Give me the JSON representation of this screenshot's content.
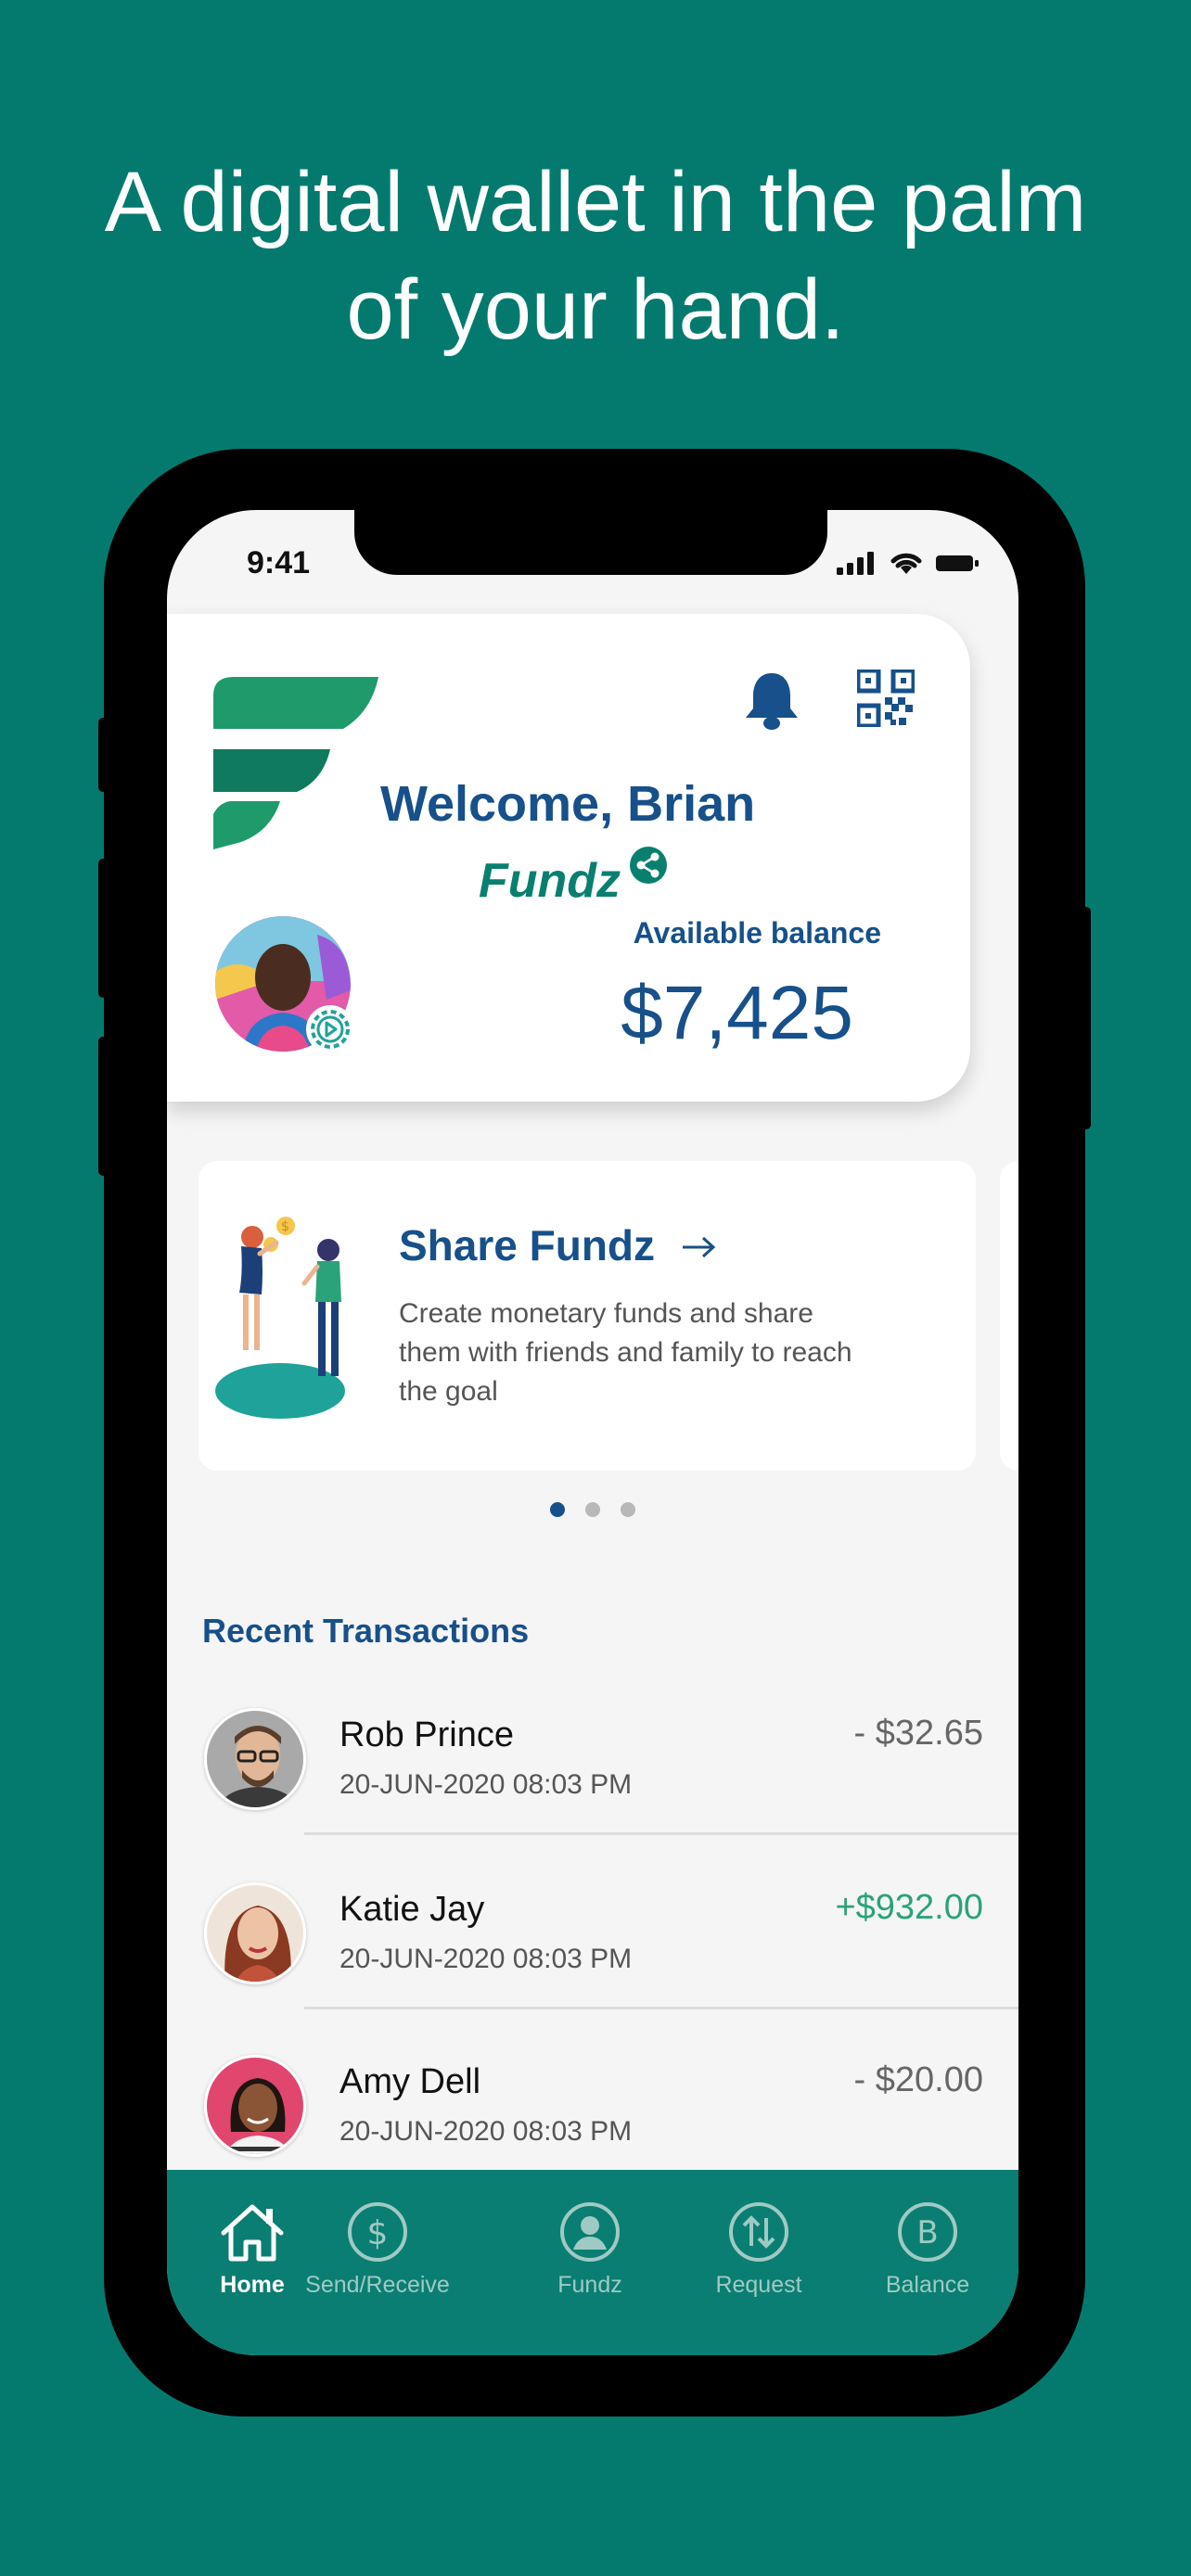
{
  "headline": {
    "line1": "A digital wallet in the palm",
    "line2": "of your hand."
  },
  "status_bar": {
    "time": "9:41"
  },
  "header": {
    "welcome": "Welcome, Brian",
    "brand": "Fundz",
    "available_label": "Available balance",
    "balance": "$7,425"
  },
  "promo": {
    "title": "Share Fundz",
    "description": "Create monetary funds and share them with friends and family to reach the goal",
    "page_count": 3,
    "active_page": 1
  },
  "transactions": {
    "title": "Recent Transactions",
    "items": [
      {
        "name": "Rob Prince",
        "date": "20-JUN-2020 08:03 PM",
        "amount": "- $32.65",
        "direction": "debit"
      },
      {
        "name": "Katie Jay",
        "date": "20-JUN-2020 08:03 PM",
        "amount": "+$932.00",
        "direction": "credit"
      },
      {
        "name": "Amy Dell",
        "date": "20-JUN-2020 08:03 PM",
        "amount": "- $20.00",
        "direction": "debit"
      }
    ]
  },
  "nav": {
    "items": [
      {
        "label": "Home",
        "icon": "home-icon",
        "active": true
      },
      {
        "label": "Send/Receive",
        "icon": "dollar-circle-icon",
        "active": false
      },
      {
        "label": "Fundz",
        "icon": "user-circle-icon",
        "active": false
      },
      {
        "label": "Request",
        "icon": "arrows-updown-icon",
        "active": false
      },
      {
        "label": "Balance",
        "icon": "b-circle-icon",
        "active": false
      }
    ]
  },
  "colors": {
    "background": "#047a6f",
    "primary_blue": "#17508a",
    "brand_green": "#09806f",
    "nav_bar": "#0a7e72",
    "credit_green": "#2aa37a"
  }
}
